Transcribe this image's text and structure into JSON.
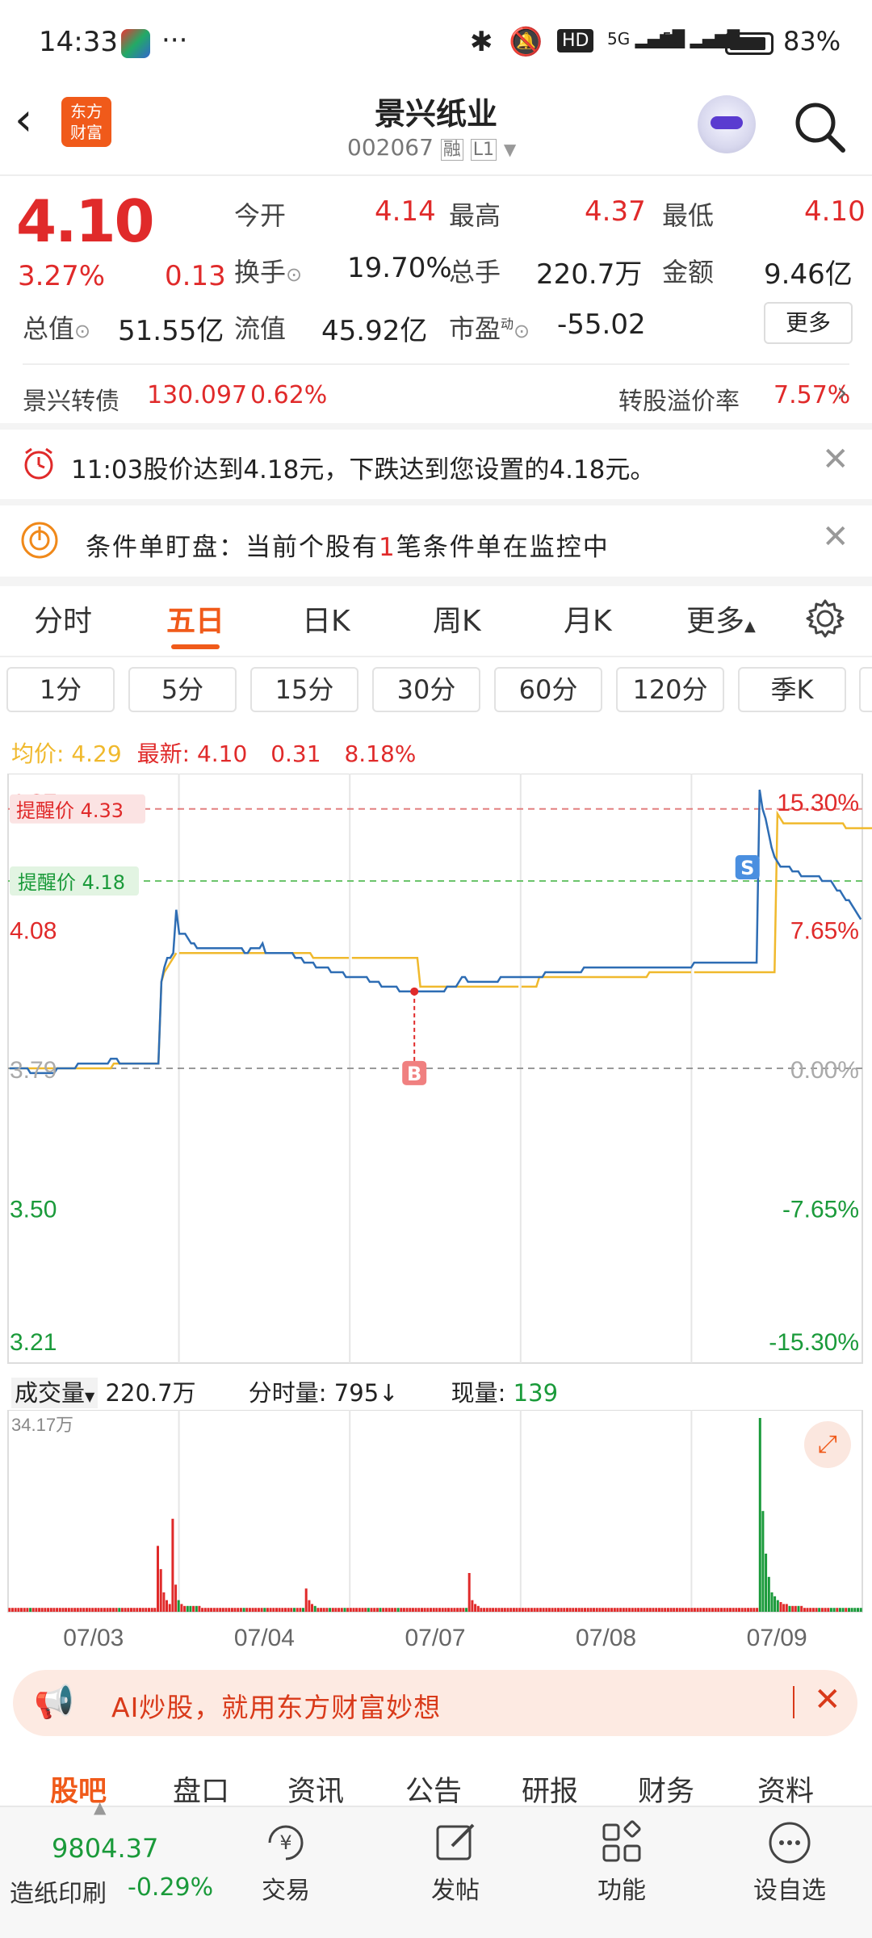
{
  "status_bar": {
    "time": "14:33",
    "dots": "···",
    "battery": "83%",
    "hd": "HD",
    "net1": "5G",
    "net2": "5G"
  },
  "header": {
    "logo_line1": "东方",
    "logo_line2": "财富",
    "title": "景兴纸业",
    "code": "002067",
    "tag1": "融",
    "tag2": "L1"
  },
  "quote": {
    "price": "4.10",
    "pct": "3.27%",
    "change": "0.13",
    "open_label": "今开",
    "open": "4.14",
    "high_label": "最高",
    "high": "4.37",
    "low_label": "最低",
    "low": "4.10",
    "turnover_label": "换手",
    "turnover": "19.70%",
    "volume_label": "总手",
    "volume": "220.7万",
    "amount_label": "金额",
    "amount": "9.46亿",
    "mktcap_label": "总值",
    "mktcap": "51.55亿",
    "float_label": "流值",
    "float": "45.92亿",
    "pe_label": "市盈",
    "pe_sup": "动",
    "pe": "-55.02",
    "more_btn": "更多"
  },
  "bond": {
    "name": "景兴转债",
    "price": "130.097",
    "pct": "0.62%",
    "premium_label": "转股溢价率",
    "premium": "7.57%"
  },
  "alerts": [
    {
      "text": "11:03股价达到4.18元，下跌达到您设置的4.18元。"
    },
    {
      "text_a": "条件单盯盘：当前个股有",
      "text_b": "1",
      "text_c": "笔条件单在监控中"
    }
  ],
  "main_tabs": [
    "分时",
    "五日",
    "日K",
    "周K",
    "月K",
    "更多"
  ],
  "active_tab": "五日",
  "sub_tabs": [
    "1分",
    "5分",
    "15分",
    "30分",
    "60分",
    "120分",
    "季K"
  ],
  "chart_info": {
    "avg_label": "均价:",
    "avg": "4.29",
    "latest_label": "最新:",
    "latest": "4.10",
    "chg": "0.31",
    "pct": "8.18%"
  },
  "chart_data": {
    "type": "line",
    "days": [
      "07/03",
      "07/04",
      "07/07",
      "07/08",
      "07/09"
    ],
    "y_left": [
      "4.37",
      "4.08",
      "3.79",
      "3.50",
      "3.21"
    ],
    "y_right": [
      "15.30%",
      "7.65%",
      "0.00%",
      "-7.65%",
      "-15.30%"
    ],
    "ylim": [
      3.21,
      4.37
    ],
    "alert_high_label": "提醒价",
    "alert_high": "4.33",
    "alert_low_label": "提醒价",
    "alert_low": "4.18",
    "buy_marker": "B",
    "sell_marker": "S",
    "series": [
      {
        "name": "price",
        "values": [
          3.79,
          3.79,
          3.79,
          3.79,
          3.79,
          3.79,
          3.79,
          3.78,
          3.78,
          3.78,
          3.78,
          3.78,
          3.78,
          3.78,
          3.78,
          3.78,
          3.79,
          3.79,
          3.79,
          3.79,
          3.79,
          3.79,
          3.79,
          3.8,
          3.8,
          3.8,
          3.8,
          3.8,
          3.8,
          3.8,
          3.8,
          3.8,
          3.8,
          3.8,
          3.81,
          3.81,
          3.81,
          3.8,
          3.8,
          3.8,
          3.8,
          3.8,
          3.8,
          3.8,
          3.8,
          3.8,
          3.8,
          3.8,
          3.8,
          3.8,
          3.8,
          3.97,
          4.0,
          4.02,
          4.02,
          4.03,
          4.12,
          4.07,
          4.07,
          4.07,
          4.06,
          4.05,
          4.05,
          4.04,
          4.04,
          4.04,
          4.04,
          4.04,
          4.04,
          4.04,
          4.04,
          4.04,
          4.04,
          4.04,
          4.04,
          4.04,
          4.04,
          4.04,
          4.04,
          4.03,
          4.03,
          4.04,
          4.04,
          4.04,
          4.04,
          4.05,
          4.03,
          4.03,
          4.03,
          4.03,
          4.03,
          4.03,
          4.03,
          4.03,
          4.03,
          4.03,
          4.02,
          4.02,
          4.02,
          4.01,
          4.01,
          4.01,
          4.01,
          4.0,
          4.0,
          4.0,
          4.0,
          4.0,
          3.99,
          3.99,
          3.99,
          3.99,
          3.99,
          3.98,
          3.98,
          3.98,
          3.98,
          3.98,
          3.98,
          3.98,
          3.98,
          3.97,
          3.97,
          3.97,
          3.97,
          3.96,
          3.96,
          3.96,
          3.96,
          3.96,
          3.96,
          3.95,
          3.95,
          3.95,
          3.95,
          3.95,
          3.95,
          3.95,
          3.95,
          3.95,
          3.95,
          3.95,
          3.95,
          3.95,
          3.95,
          3.95,
          3.95,
          3.96,
          3.96,
          3.96,
          3.96,
          3.97,
          3.98,
          3.98,
          3.97,
          3.97,
          3.97,
          3.97,
          3.97,
          3.97,
          3.97,
          3.97,
          3.97,
          3.97,
          3.97,
          3.98,
          3.98,
          3.98,
          3.98,
          3.98,
          3.98,
          3.98,
          3.98,
          3.98,
          3.98,
          3.98,
          3.98,
          3.98,
          3.98,
          3.98,
          3.99,
          3.99,
          3.99,
          3.99,
          3.99,
          3.99,
          3.99,
          3.99,
          3.99,
          3.99,
          3.99,
          3.99,
          3.99,
          4.0,
          4.0,
          4.0,
          4.0,
          4.0,
          4.0,
          4.0,
          4.0,
          4.0,
          4.0,
          4.0,
          4.0,
          4.0,
          4.0,
          4.0,
          4.0,
          4.0,
          4.0,
          4.0,
          4.0,
          4.0,
          4.0,
          4.0,
          4.0,
          4.0,
          4.0,
          4.0,
          4.0,
          4.0,
          4.0,
          4.0,
          4.0,
          4.0,
          4.0,
          4.0,
          4.0,
          4.0,
          4.01,
          4.01,
          4.01,
          4.01,
          4.01,
          4.01,
          4.01,
          4.01,
          4.01,
          4.01,
          4.01,
          4.01,
          4.01,
          4.01,
          4.01,
          4.01,
          4.01,
          4.01,
          4.01,
          4.01,
          4.01,
          4.01,
          4.37,
          4.33,
          4.31,
          4.28,
          4.25,
          4.23,
          4.22,
          4.21,
          4.21,
          4.21,
          4.21,
          4.2,
          4.2,
          4.2,
          4.19,
          4.19,
          4.19,
          4.19,
          4.19,
          4.19,
          4.19,
          4.18,
          4.18,
          4.18,
          4.18,
          4.17,
          4.16,
          4.16,
          4.15,
          4.14,
          4.14,
          4.13,
          4.12,
          4.11,
          4.1
        ]
      },
      {
        "name": "avg",
        "values": [
          3.79,
          3.79,
          3.79,
          3.79,
          3.79,
          3.79,
          3.79,
          3.79,
          3.79,
          3.79,
          3.79,
          3.79,
          3.79,
          3.79,
          3.79,
          3.79,
          3.79,
          3.79,
          3.79,
          3.79,
          3.79,
          3.79,
          3.79,
          3.79,
          3.79,
          3.79,
          3.79,
          3.79,
          3.79,
          3.79,
          3.79,
          3.79,
          3.79,
          3.79,
          3.79,
          3.8,
          3.8,
          3.8,
          3.8,
          3.8,
          3.8,
          3.8,
          3.8,
          3.8,
          3.8,
          3.8,
          3.8,
          3.8,
          3.8,
          3.8,
          3.8,
          3.97,
          3.99,
          4.0,
          4.01,
          4.02,
          4.03,
          4.03,
          4.03,
          4.03,
          4.03,
          4.03,
          4.03,
          4.03,
          4.03,
          4.03,
          4.03,
          4.03,
          4.03,
          4.03,
          4.03,
          4.03,
          4.03,
          4.03,
          4.03,
          4.03,
          4.03,
          4.03,
          4.03,
          4.03,
          4.03,
          4.03,
          4.03,
          4.03,
          4.03,
          4.03,
          4.03,
          4.03,
          4.03,
          4.03,
          4.03,
          4.03,
          4.03,
          4.03,
          4.03,
          4.03,
          4.03,
          4.03,
          4.03,
          4.03,
          4.03,
          4.03,
          4.02,
          4.02,
          4.02,
          4.02,
          4.02,
          4.02,
          4.02,
          4.02,
          4.02,
          4.02,
          4.02,
          4.02,
          4.02,
          4.02,
          4.02,
          4.02,
          4.02,
          4.02,
          4.02,
          4.02,
          4.02,
          4.02,
          4.02,
          4.02,
          4.02,
          4.02,
          4.02,
          4.02,
          4.02,
          4.02,
          4.02,
          4.02,
          4.02,
          4.02,
          4.02,
          4.02,
          3.96,
          3.96,
          3.96,
          3.96,
          3.96,
          3.96,
          3.96,
          3.96,
          3.96,
          3.96,
          3.96,
          3.96,
          3.96,
          3.96,
          3.96,
          3.96,
          3.96,
          3.96,
          3.96,
          3.96,
          3.96,
          3.96,
          3.96,
          3.96,
          3.96,
          3.96,
          3.96,
          3.96,
          3.96,
          3.96,
          3.96,
          3.96,
          3.96,
          3.96,
          3.96,
          3.96,
          3.96,
          3.96,
          3.96,
          3.96,
          3.98,
          3.98,
          3.98,
          3.98,
          3.98,
          3.98,
          3.98,
          3.98,
          3.98,
          3.98,
          3.98,
          3.98,
          3.98,
          3.98,
          3.98,
          3.98,
          3.98,
          3.98,
          3.98,
          3.98,
          3.98,
          3.98,
          3.98,
          3.98,
          3.98,
          3.98,
          3.98,
          3.98,
          3.98,
          3.98,
          3.98,
          3.98,
          3.98,
          3.98,
          3.98,
          3.98,
          3.98,
          3.99,
          3.99,
          3.99,
          3.99,
          3.99,
          3.99,
          3.99,
          3.99,
          3.99,
          3.99,
          3.99,
          3.99,
          3.99,
          3.99,
          3.99,
          3.99,
          3.99,
          3.99,
          3.99,
          3.99,
          3.99,
          3.99,
          3.99,
          3.99,
          3.99,
          3.99,
          3.99,
          3.99,
          3.99,
          3.99,
          3.99,
          3.99,
          3.99,
          3.99,
          3.99,
          3.99,
          3.99,
          3.99,
          3.99,
          3.99,
          3.99,
          3.99,
          3.99,
          4.32,
          4.31,
          4.3,
          4.3,
          4.3,
          4.3,
          4.3,
          4.3,
          4.3,
          4.3,
          4.3,
          4.3,
          4.3,
          4.3,
          4.3,
          4.3,
          4.3,
          4.3,
          4.3,
          4.3,
          4.3,
          4.3,
          4.3,
          4.29,
          4.29,
          4.29,
          4.29,
          4.29,
          4.29,
          4.29,
          4.29,
          4.29,
          4.29,
          4.29,
          4.29,
          4.29
        ]
      }
    ],
    "volume": {
      "max_label": "34.17万",
      "peaks": [
        0.02,
        0.02,
        0.02,
        0.02,
        0.02,
        0.02,
        0.02,
        0.02,
        0.02,
        0.02,
        0.02,
        0.02,
        0.02,
        0.02,
        0.02,
        0.02,
        0.02,
        0.02,
        0.02,
        0.02,
        0.02,
        0.02,
        0.02,
        0.02,
        0.02,
        0.02,
        0.02,
        0.02,
        0.02,
        0.02,
        0.02,
        0.02,
        0.02,
        0.02,
        0.02,
        0.02,
        0.02,
        0.02,
        0.02,
        0.02,
        0.02,
        0.02,
        0.02,
        0.02,
        0.02,
        0.02,
        0.02,
        0.02,
        0.02,
        0.02,
        0.34,
        0.22,
        0.1,
        0.06,
        0.04,
        0.48,
        0.14,
        0.06,
        0.04,
        0.03,
        0.03,
        0.03,
        0.03,
        0.03,
        0.03,
        0.02,
        0.02,
        0.02,
        0.02,
        0.02,
        0.02,
        0.02,
        0.02,
        0.02,
        0.02,
        0.02,
        0.02,
        0.02,
        0.02,
        0.02,
        0.02,
        0.02,
        0.02,
        0.02,
        0.02,
        0.02,
        0.02,
        0.02,
        0.02,
        0.02,
        0.02,
        0.02,
        0.02,
        0.02,
        0.02,
        0.02,
        0.02,
        0.02,
        0.02,
        0.02,
        0.12,
        0.06,
        0.04,
        0.03,
        0.02,
        0.02,
        0.02,
        0.02,
        0.02,
        0.02,
        0.02,
        0.02,
        0.02,
        0.02,
        0.02,
        0.02,
        0.02,
        0.02,
        0.02,
        0.02,
        0.02,
        0.02,
        0.02,
        0.02,
        0.02,
        0.02,
        0.02,
        0.02,
        0.02,
        0.02,
        0.02,
        0.02,
        0.02,
        0.02,
        0.02,
        0.02,
        0.02,
        0.02,
        0.02,
        0.02,
        0.02,
        0.02,
        0.02,
        0.02,
        0.02,
        0.02,
        0.02,
        0.02,
        0.02,
        0.02,
        0.02,
        0.02,
        0.02,
        0.02,
        0.02,
        0.2,
        0.06,
        0.04,
        0.03,
        0.02,
        0.02,
        0.02,
        0.02,
        0.02,
        0.02,
        0.02,
        0.02,
        0.02,
        0.02,
        0.02,
        0.02,
        0.02,
        0.02,
        0.02,
        0.02,
        0.02,
        0.02,
        0.02,
        0.02,
        0.02,
        0.02,
        0.02,
        0.02,
        0.02,
        0.02,
        0.02,
        0.02,
        0.02,
        0.02,
        0.02,
        0.02,
        0.02,
        0.02,
        0.02,
        0.02,
        0.02,
        0.02,
        0.02,
        0.02,
        0.02,
        0.02,
        0.02,
        0.02,
        0.02,
        0.02,
        0.02,
        0.02,
        0.02,
        0.02,
        0.02,
        0.02,
        0.02,
        0.02,
        0.02,
        0.02,
        0.02,
        0.02,
        0.02,
        0.02,
        0.02,
        0.02,
        0.02,
        0.02,
        0.02,
        0.02,
        0.02,
        0.02,
        0.02,
        0.02,
        0.02,
        0.02,
        0.02,
        0.02,
        0.02,
        0.02,
        0.02,
        0.02,
        0.02,
        0.02,
        0.02,
        0.02,
        0.02,
        0.02,
        0.02,
        0.02,
        0.02,
        0.02,
        0.02,
        0.02,
        0.02,
        0.02,
        0.02,
        0.02,
        1.0,
        0.52,
        0.3,
        0.18,
        0.1,
        0.08,
        0.06,
        0.05,
        0.04,
        0.04,
        0.03,
        0.03,
        0.03,
        0.03,
        0.03,
        0.02,
        0.02,
        0.02,
        0.02,
        0.02,
        0.02,
        0.02,
        0.02,
        0.02,
        0.02,
        0.02,
        0.02,
        0.02,
        0.02,
        0.02,
        0.02,
        0.02,
        0.02,
        0.02,
        0.02
      ]
    }
  },
  "volume_bar": {
    "label": "成交量",
    "total": "220.7万",
    "tick_label": "分时量:",
    "tick": "795↓",
    "now_label": "现量:",
    "now": "139"
  },
  "promo": {
    "text": "AI炒股，就用东方财富妙想"
  },
  "bottom_tabs": [
    "股吧",
    "盘口",
    "资讯",
    "公告",
    "研报",
    "财务",
    "资料"
  ],
  "index": {
    "value": "9804.37",
    "name": "造纸印刷",
    "pct": "-0.29%"
  },
  "dock": [
    "交易",
    "发帖",
    "功能",
    "设自选"
  ],
  "colors": {
    "up": "#e02a2a",
    "down": "#1a9a3a",
    "accent": "#f05a1a",
    "line": "#2e6db4",
    "avg": "#f0b92d"
  }
}
